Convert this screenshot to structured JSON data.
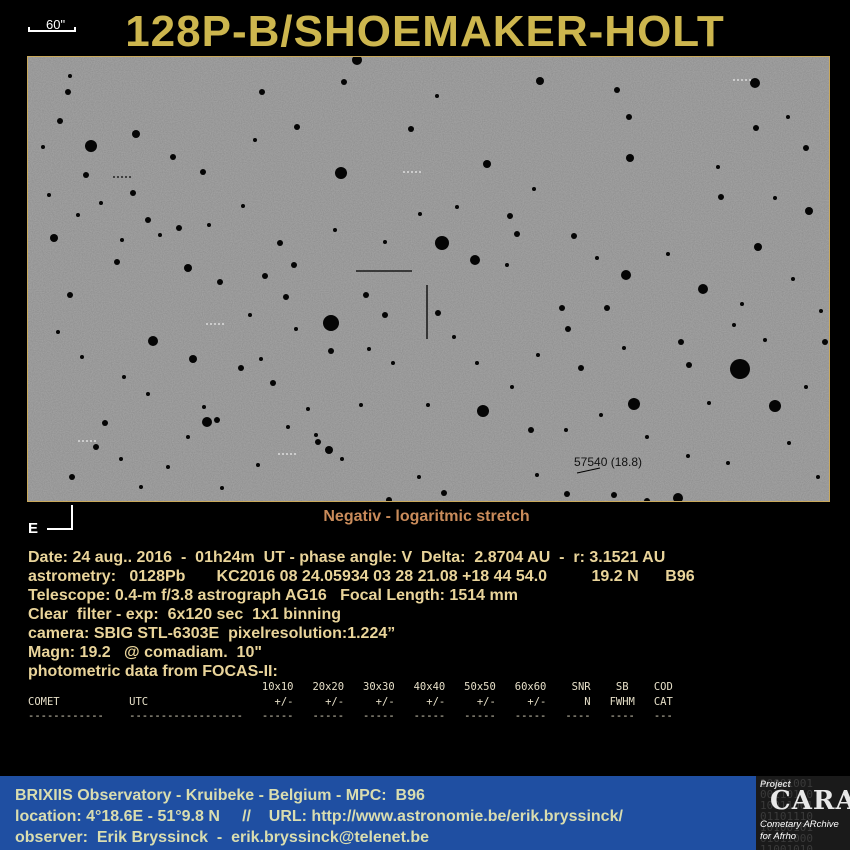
{
  "title": "128P-B/SHOEMAKER-HOLT",
  "scale_label": "60\"",
  "east_label": "E",
  "star_label": "57540 (18.8)",
  "caption": "Negativ - logaritmic stretch",
  "info_lines": [
    "Date: 24 aug.. 2016  -  01h24m  UT - phase angle: V  Delta:  2.8704 AU  -  r: 3.1521 AU",
    "astrometry:   0128Pb       KC2016 08 24.05934 03 28 21.08 +18 44 54.0          19.2 N      B96",
    "Telescope: 0.4-m f/3.8 astrograph AG16   Focal Length: 1514 mm",
    "Clear  filter - exp:  6x120 sec  1x1 binning",
    "camera: SBIG STL-6303E  pixelresolution:1.224”",
    "Magn: 19.2   @ comadiam.  10\"",
    "photometric data from FOCAS-II:"
  ],
  "table": {
    "header1": "                                     10x10   20x20   30x30   40x40   50x50   60x60    SNR    SB    COD",
    "header2": "COMET           UTC                    +/-     +/-     +/-     +/-     +/-     +/-      N   FWHM   CAT",
    "rule": "------------    ------------------   -----   -----   -----   -----   -----   -----   ----   ----   ---"
  },
  "footer": {
    "line1": "BRIXIIS Observatory - Kruibeke - Belgium - MPC:  B96",
    "line2": "location: 4°18.6E - 51°9.8 N     //    URL: http://www.astronomie.be/erik.bryssinck/",
    "line3": "observer:  Erik Bryssinck  -  erik.bryssinck@telenet.be"
  },
  "logo": {
    "project": "Project",
    "name": "CARA",
    "sub1": "Cometary ARchive",
    "sub2": "for Afrho"
  }
}
